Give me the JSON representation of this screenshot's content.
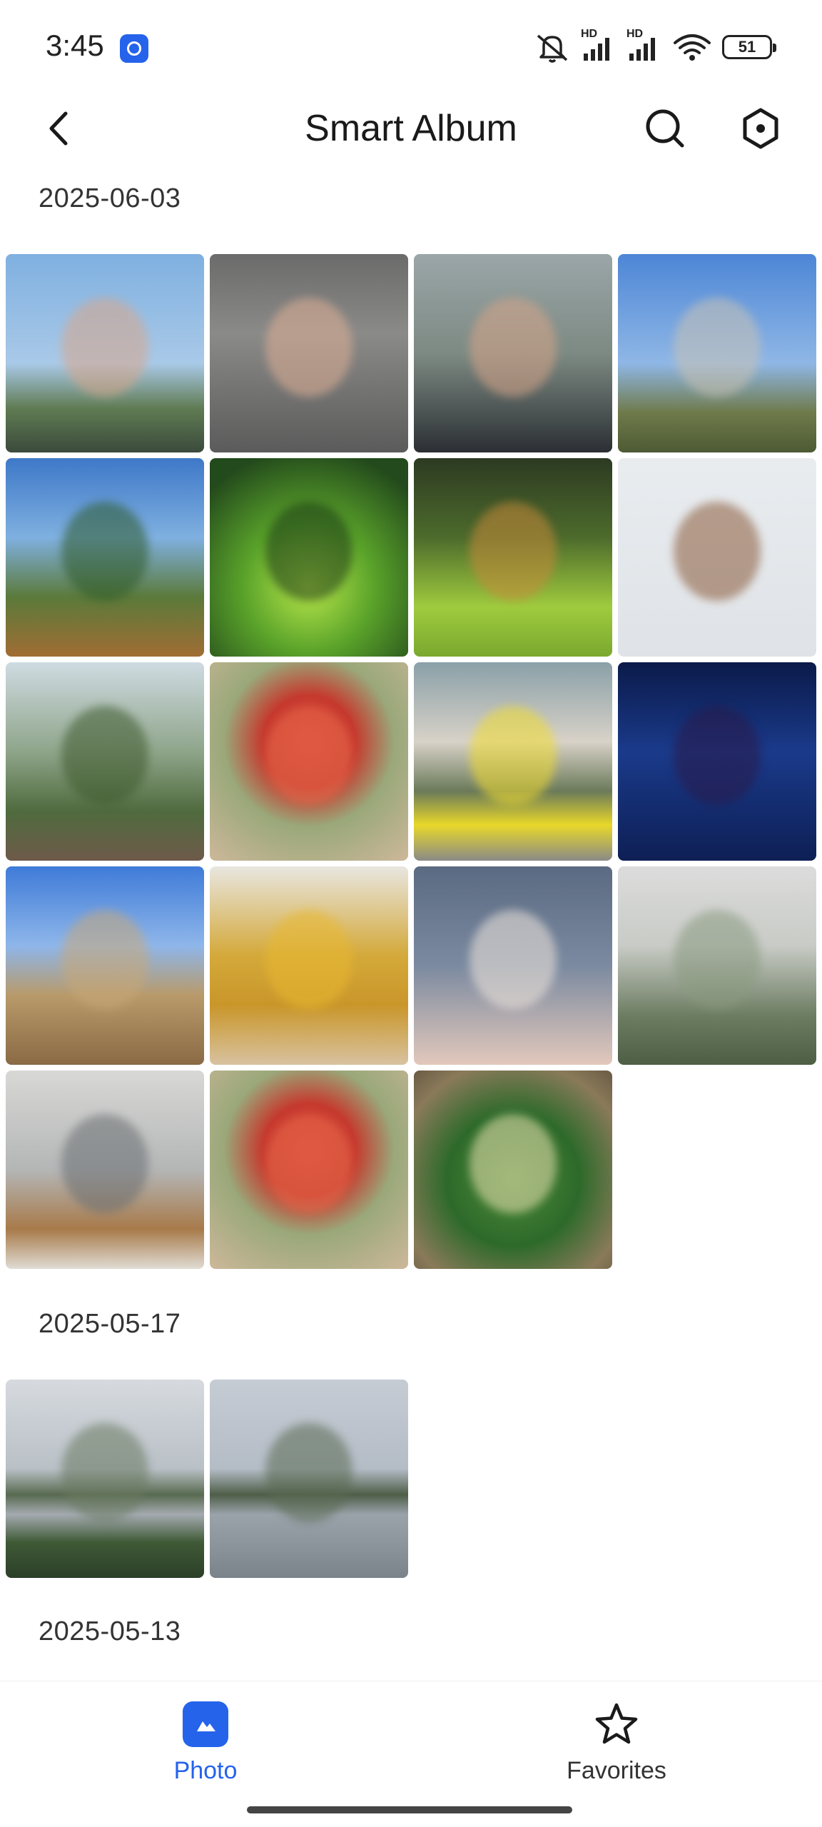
{
  "status_bar": {
    "time": "3:45",
    "battery": "51",
    "signal_1_label": "HD",
    "signal_2_label": "HD"
  },
  "header": {
    "title": "Smart Album"
  },
  "sections": [
    {
      "date": "2025-06-03",
      "photos": [
        {
          "name": "photo-portrait-man-outdoor",
          "bg": "linear-gradient(180deg,#7fb0e0 0%,#a9c9e8 55%,#5f7b52 78%,#3b4a3c 100%)",
          "accent": "#d8a68a"
        },
        {
          "name": "photo-portrait-man-smiling",
          "bg": "linear-gradient(180deg,#6b6b6b 0%,#8a8a88 40%,#5b5b5b 100%)",
          "accent": "#e0b095"
        },
        {
          "name": "photo-portrait-man-glasses",
          "bg": "linear-gradient(180deg,#9aa6a8 0%,#7d8a83 50%,#2b2f33 100%)",
          "accent": "#d7a488"
        },
        {
          "name": "photo-bare-trees-sky",
          "bg": "linear-gradient(180deg,#4d86d6 0%,#8fb7e6 55%,#6f7a4a 80%,#4d5a34 100%)",
          "accent": "#c9c2b4"
        },
        {
          "name": "photo-forest-canopy",
          "bg": "linear-gradient(180deg,#3e78c8 0%,#7fb0e0 40%,#5b7a3a 70%,#a06d34 100%)",
          "accent": "#2f5a2a"
        },
        {
          "name": "photo-green-moss-plant",
          "bg": "radial-gradient(circle at 50% 65%,#b8e64a 0%,#5aa32a 40%,#234a1c 85%)",
          "accent": "#1d3a18"
        },
        {
          "name": "photo-garden-grass",
          "bg": "linear-gradient(180deg,#2c3a22 0%,#4d6b2c 40%,#9fcb3e 75%,#7aa82e 100%)",
          "accent": "#c88a3a"
        },
        {
          "name": "photo-butterfly-specimens",
          "bg": "linear-gradient(180deg,#e9ecef 0%,#dfe3e7 100%)",
          "accent": "#8a5a3a"
        },
        {
          "name": "photo-greenhouse-palms",
          "bg": "linear-gradient(180deg,#cfdbe2 0%,#8fa58a 45%,#4f6b3e 75%,#6e5a4a 100%)",
          "accent": "#3f5a2e"
        },
        {
          "name": "photo-red-cactus-flower",
          "bg": "radial-gradient(circle at 50% 40%,#d9453a 0%,#c53a2e 30%,#9aa87a 55%,#cdb89a 100%)",
          "accent": "#e86a4a"
        },
        {
          "name": "photo-yellow-beetle-car",
          "bg": "linear-gradient(180deg,#8aa0a8 0%,#d8d2c8 40%,#6b7a5a 65%,#e8d82a 82%,#8a8a86 100%)",
          "accent": "#f0dc30"
        },
        {
          "name": "photo-concert-singer",
          "bg": "linear-gradient(180deg,#0b1a4a 0%,#1a3a8a 45%,#0e1f55 100%)",
          "accent": "#2a1a4a"
        },
        {
          "name": "photo-fluffy-cat",
          "bg": "linear-gradient(180deg,#3f7bd8 0%,#8eb6ea 40%,#b89a6a 65%,#8a6a44 100%)",
          "accent": "#c8a878"
        },
        {
          "name": "photo-golden-lucky-cat",
          "bg": "linear-gradient(180deg,#e8e6e0 0%,#d4a93a 45%,#c9962a 70%,#d8c2a0 100%)",
          "accent": "#e8b830"
        },
        {
          "name": "photo-crochet-pig-toy",
          "bg": "linear-gradient(180deg,#5a6a82 0%,#7b8aa0 50%,#e2c8bc 100%)",
          "accent": "#f0e6dc"
        },
        {
          "name": "photo-rainy-window-view",
          "bg": "linear-gradient(180deg,#dcdcdc 0%,#c8cbc6 40%,#6d7d62 75%,#4e5e45 100%)",
          "accent": "#8a9a80"
        },
        {
          "name": "photo-desk-fan",
          "bg": "linear-gradient(180deg,#d8d8d6 0%,#b4b6b6 50%,#a87a4a 80%,#e0dcd4 100%)",
          "accent": "#6a6e72"
        },
        {
          "name": "photo-red-cactus-flower-2",
          "bg": "radial-gradient(circle at 50% 40%,#d9453a 0%,#c53a2e 30%,#9aa87a 55%,#cdb89a 100%)",
          "accent": "#e86a4a"
        },
        {
          "name": "photo-barrel-cactus",
          "bg": "radial-gradient(circle at 50% 55%,#4f8a3a 0%,#2d6a2a 45%,#8a7a5a 80%,#6a5a44 100%)",
          "accent": "#e8e0b0"
        }
      ]
    },
    {
      "date": "2025-05-17",
      "photos": [
        {
          "name": "photo-lake-landscape-1",
          "bg": "linear-gradient(180deg,#d6dadf 0%,#b9c0c6 45%,#586a50 58%,#a4aab0 68%,#3f5a36 82%,#2c3f28 100%)",
          "accent": "#6a7a62"
        },
        {
          "name": "photo-lake-landscape-2",
          "bg": "linear-gradient(180deg,#c6ccd4 0%,#b4bcc6 45%,#4e5e48 58%,#9aa2aa 68%,#8a929a 85%,#7a828a 100%)",
          "accent": "#5a6a52"
        }
      ]
    },
    {
      "date": "2025-05-13",
      "photos": []
    }
  ],
  "bottom_nav": {
    "items": [
      {
        "label": "Photo",
        "active": true
      },
      {
        "label": "Favorites",
        "active": false
      }
    ]
  },
  "colors": {
    "accent": "#2563eb"
  }
}
